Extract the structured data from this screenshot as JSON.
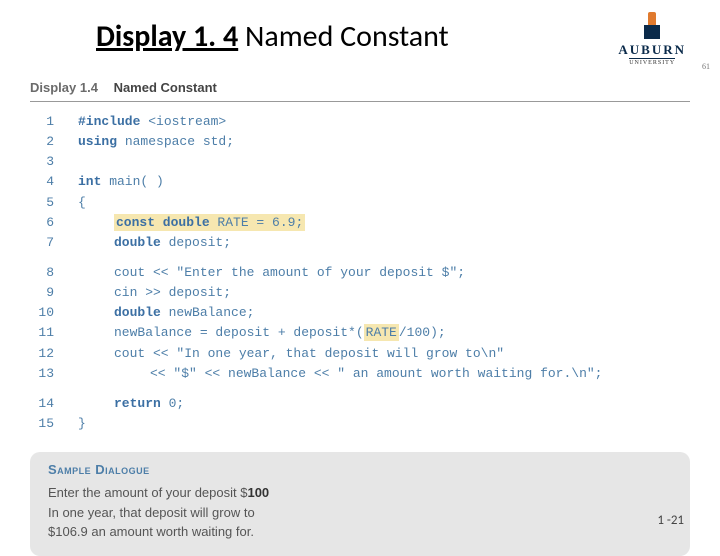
{
  "slide": {
    "title_bold": "Display 1. 4",
    "title_rest": "  Named Constant",
    "footer_num": "1 -21"
  },
  "logo": {
    "name": "AUBURN",
    "sub": "UNIVERSITY"
  },
  "book": {
    "display_label": "Display 1.4",
    "display_name": "Named Constant",
    "page_hint": "61"
  },
  "code": {
    "block1": {
      "nums": [
        "1",
        "2",
        "3",
        "4",
        "5",
        "6",
        "7"
      ],
      "lines": {
        "l1a": "#include",
        "l1b": " <iostream>",
        "l2a": "using",
        "l2b": " namespace std;",
        "l3": "",
        "l4a": "int",
        "l4b": " main( )",
        "l5": "{",
        "l6a": "const double",
        "l6b": " RATE = 6.9;",
        "l7a": "double",
        "l7b": " deposit;"
      }
    },
    "block2": {
      "nums": [
        "8",
        "9",
        "10",
        "11",
        "12",
        "13"
      ],
      "lines": {
        "l8": "cout << \"Enter the amount of your deposit $\";",
        "l9": "cin >> deposit;",
        "l10a": "double",
        "l10b": " newBalance;",
        "l11a": "newBalance = deposit + deposit*(",
        "l11b": "RATE",
        "l11c": "/100);",
        "l12": "cout << \"In one year, that deposit will grow to\\n\"",
        "l13": "<< \"$\" << newBalance << \" an amount worth waiting for.\\n\";"
      }
    },
    "block3": {
      "nums": [
        "14",
        "15"
      ],
      "lines": {
        "l14a": "return",
        "l14b": " 0;",
        "l15": "}"
      }
    }
  },
  "dialogue": {
    "title": "Sample Dialogue",
    "line1_pre": "Enter the amount of your deposit $",
    "line1_input": "100",
    "line2": "In one year, that deposit will grow to",
    "line3": "$106.9 an amount worth waiting for."
  }
}
